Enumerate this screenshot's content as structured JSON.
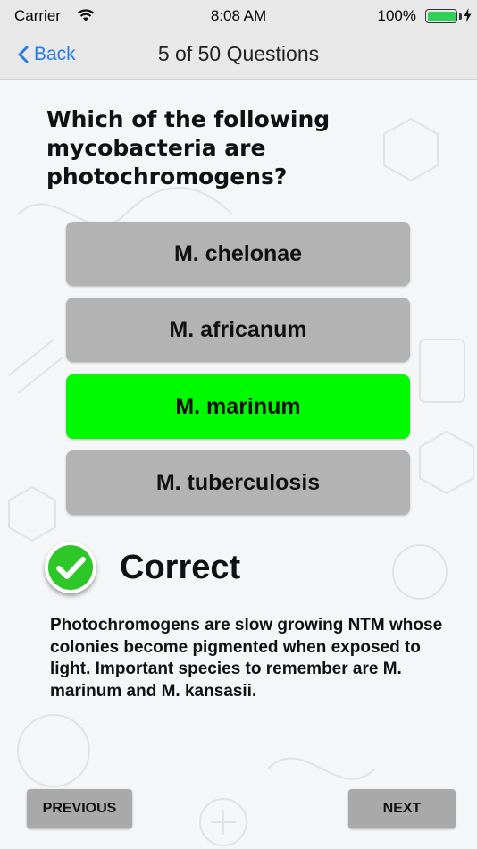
{
  "status_bar": {
    "carrier": "Carrier",
    "time": "8:08 AM",
    "battery_percent": "100%"
  },
  "nav": {
    "back_label": "Back",
    "title": "5 of 50 Questions"
  },
  "question": {
    "text": "Which of the following mycobacteria are photochromogens?"
  },
  "answers": [
    {
      "label": "M. chelonae",
      "state": "default"
    },
    {
      "label": "M. africanum",
      "state": "default"
    },
    {
      "label": "M. marinum",
      "state": "correct"
    },
    {
      "label": "M. tuberculosis",
      "state": "default"
    }
  ],
  "result": {
    "label": "Correct",
    "icon": "check-circle-icon"
  },
  "explanation": {
    "text": "Photochromogens are slow growing NTM whose colonies become pigmented when exposed to light. Important species to remember are M. marinum and M. kansasii."
  },
  "footer": {
    "previous_label": "PREVIOUS",
    "next_label": "NEXT"
  },
  "colors": {
    "accent": "#2a7be4",
    "correct_answer": "#00fa00",
    "answer_default": "#b3b3b3",
    "check_green": "#2ec728",
    "battery_green": "#30d158"
  }
}
